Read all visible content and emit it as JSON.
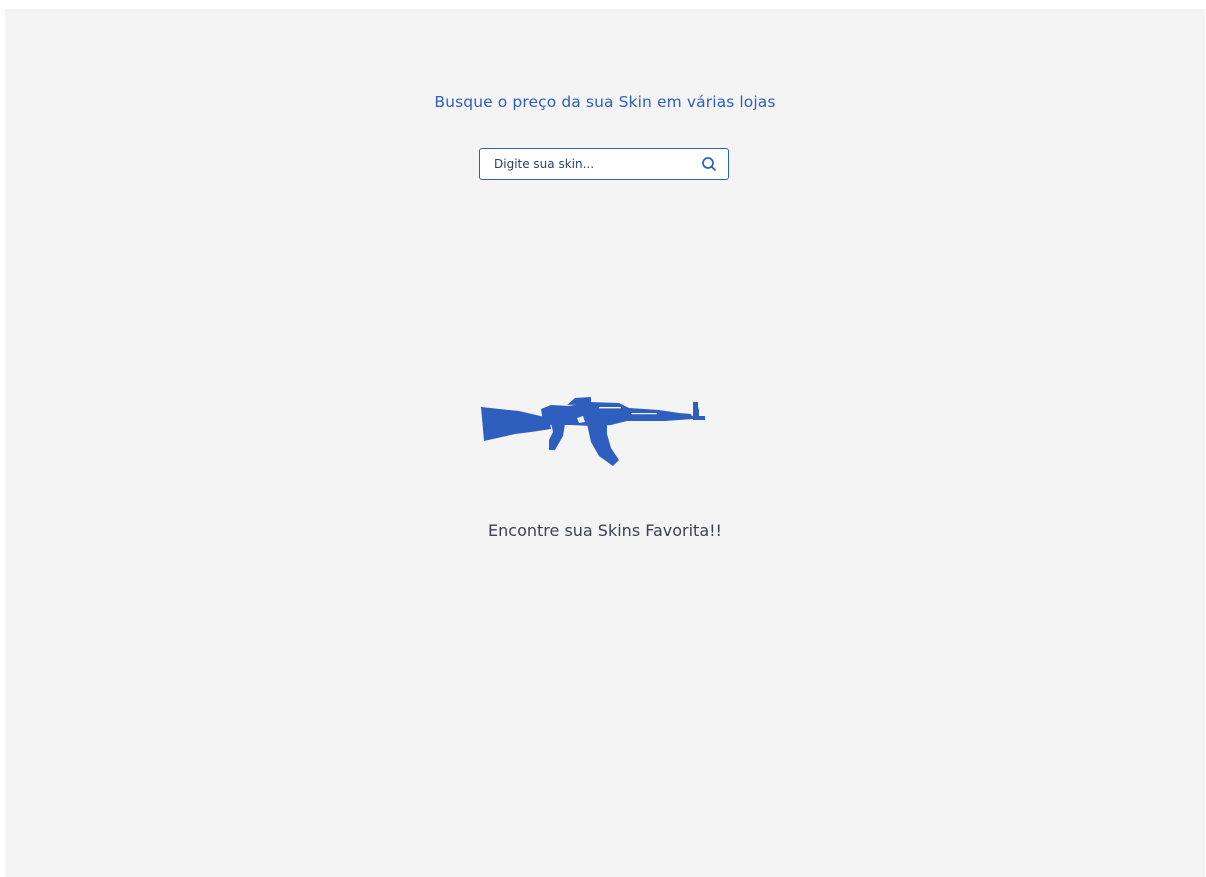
{
  "header": {
    "title": "Busque o preço da sua Skin em várias lojas"
  },
  "search": {
    "placeholder": "Digite sua skin...",
    "value": "",
    "icon": "search-icon"
  },
  "hero": {
    "icon": "rifle-icon",
    "tagline": "Encontre sua Skins Favorita!!"
  },
  "colors": {
    "accent": "#2e5fbf",
    "background": "#f4f4f4",
    "text": "#3a4150"
  }
}
